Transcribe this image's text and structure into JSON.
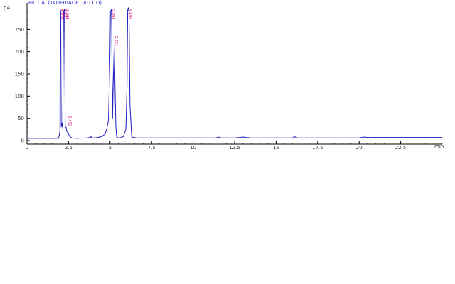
{
  "chart_data": {
    "type": "line",
    "title": "FID1 A, (TADEU\\ADET0011.D)",
    "ylabel": "pA",
    "xlabel": "",
    "xunit": "min",
    "xlim": [
      0,
      25
    ],
    "ylim": [
      0,
      300
    ],
    "xticks": [
      0,
      2.5,
      5,
      7.5,
      10,
      12.5,
      15,
      17.5,
      20,
      22.5
    ],
    "xtick_labels": [
      "0",
      "2.5",
      "5",
      "7.5",
      "10",
      "12.5",
      "15",
      "17.5",
      "20",
      "22.5"
    ],
    "yticks": [
      0,
      50,
      100,
      150,
      200,
      250
    ],
    "ytick_labels": [
      "0",
      "50",
      "100",
      "150",
      "200",
      "250"
    ],
    "grid": false,
    "colors": {
      "trace": "#1f1fbf",
      "peak_labels": "#d0006f",
      "title": "#2a2ad0"
    },
    "series": [
      {
        "x": [
          0,
          1.9,
          1.98,
          2.0,
          2.03,
          2.06,
          2.1,
          2.15,
          2.2,
          2.25,
          2.3,
          2.35,
          2.4,
          2.45,
          2.5,
          2.55,
          2.6,
          2.7,
          3.0,
          3.6,
          3.8,
          3.85,
          3.9,
          4.1,
          4.5,
          4.7,
          4.8,
          4.9,
          4.95,
          5.0,
          5.02,
          5.08,
          5.1,
          5.12,
          5.15,
          5.2,
          5.25,
          5.3,
          5.35,
          5.4,
          5.5,
          5.6,
          5.8,
          5.95,
          6.02,
          6.06,
          6.1,
          6.14,
          6.2,
          6.3,
          6.6,
          8.0,
          10.0,
          11.4,
          11.5,
          11.6,
          11.7,
          12.5,
          12.8,
          13.0,
          13.2,
          13.5,
          15.0,
          16.0,
          16.1,
          16.2,
          16.3,
          17.5,
          20.0,
          20.3,
          20.5,
          20.7,
          22.5,
          25.0
        ],
        "y": [
          5,
          5,
          20,
          295,
          290,
          30,
          40,
          28,
          290,
          295,
          30,
          30,
          20,
          18,
          15,
          10,
          8,
          6,
          5,
          6,
          7,
          9,
          6,
          6,
          9,
          15,
          26,
          45,
          120,
          210,
          290,
          295,
          260,
          150,
          50,
          150,
          215,
          120,
          30,
          8,
          6,
          6,
          9,
          25,
          120,
          295,
          298,
          290,
          80,
          8,
          6,
          6,
          6,
          6,
          8,
          7,
          6,
          6,
          7,
          8,
          7,
          6,
          6,
          6,
          9,
          7,
          6,
          6,
          6,
          8,
          7,
          7,
          7,
          7
        ]
      }
    ],
    "peak_labels": [
      {
        "rt": 2.0,
        "text": "2.010",
        "y": 295
      },
      {
        "rt": 2.06,
        "text": "2.065",
        "y": 295
      },
      {
        "rt": 2.25,
        "text": "2.247",
        "y": 295
      },
      {
        "rt": 2.3,
        "text": "2.306",
        "y": 295
      },
      {
        "rt": 2.45,
        "text": "2.452",
        "y": 55
      },
      {
        "rt": 5.08,
        "text": "5.083",
        "y": 295
      },
      {
        "rt": 5.25,
        "text": "5.251",
        "y": 235
      },
      {
        "rt": 6.1,
        "text": "6.105",
        "y": 295
      }
    ]
  }
}
